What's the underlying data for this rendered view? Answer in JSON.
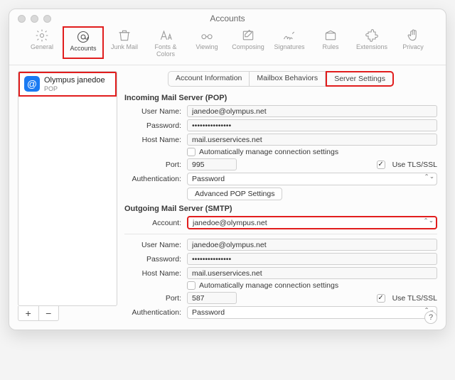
{
  "window": {
    "title": "Accounts"
  },
  "toolbar": {
    "items": [
      {
        "label": "General"
      },
      {
        "label": "Accounts"
      },
      {
        "label": "Junk Mail"
      },
      {
        "label": "Fonts & Colors"
      },
      {
        "label": "Viewing"
      },
      {
        "label": "Composing"
      },
      {
        "label": "Signatures"
      },
      {
        "label": "Rules"
      },
      {
        "label": "Extensions"
      },
      {
        "label": "Privacy"
      }
    ]
  },
  "sidebar": {
    "account": {
      "name": "Olympus janedoe",
      "protocol": "POP"
    },
    "add": "+",
    "remove": "−"
  },
  "tabs": {
    "items": [
      {
        "label": "Account Information"
      },
      {
        "label": "Mailbox Behaviors"
      },
      {
        "label": "Server Settings"
      }
    ]
  },
  "incoming": {
    "title": "Incoming Mail Server (POP)",
    "labels": {
      "user": "User Name:",
      "pass": "Password:",
      "host": "Host Name:",
      "port": "Port:",
      "auth": "Authentication:"
    },
    "user": "janedoe@olympus.net",
    "pass": "•••••••••••••••",
    "host": "mail.userservices.net",
    "auto_label": "Automatically manage connection settings",
    "port": "995",
    "tls_label": "Use TLS/SSL",
    "auth": "Password",
    "advanced": "Advanced POP Settings"
  },
  "outgoing": {
    "title": "Outgoing Mail Server (SMTP)",
    "labels": {
      "account": "Account:",
      "user": "User Name:",
      "pass": "Password:",
      "host": "Host Name:",
      "port": "Port:",
      "auth": "Authentication:"
    },
    "account": "janedoe@olympus.net",
    "user": "janedoe@olympus.net",
    "pass": "•••••••••••••••",
    "host": "mail.userservices.net",
    "auto_label": "Automatically manage connection settings",
    "port": "587",
    "tls_label": "Use TLS/SSL",
    "auth": "Password"
  },
  "help": "?"
}
